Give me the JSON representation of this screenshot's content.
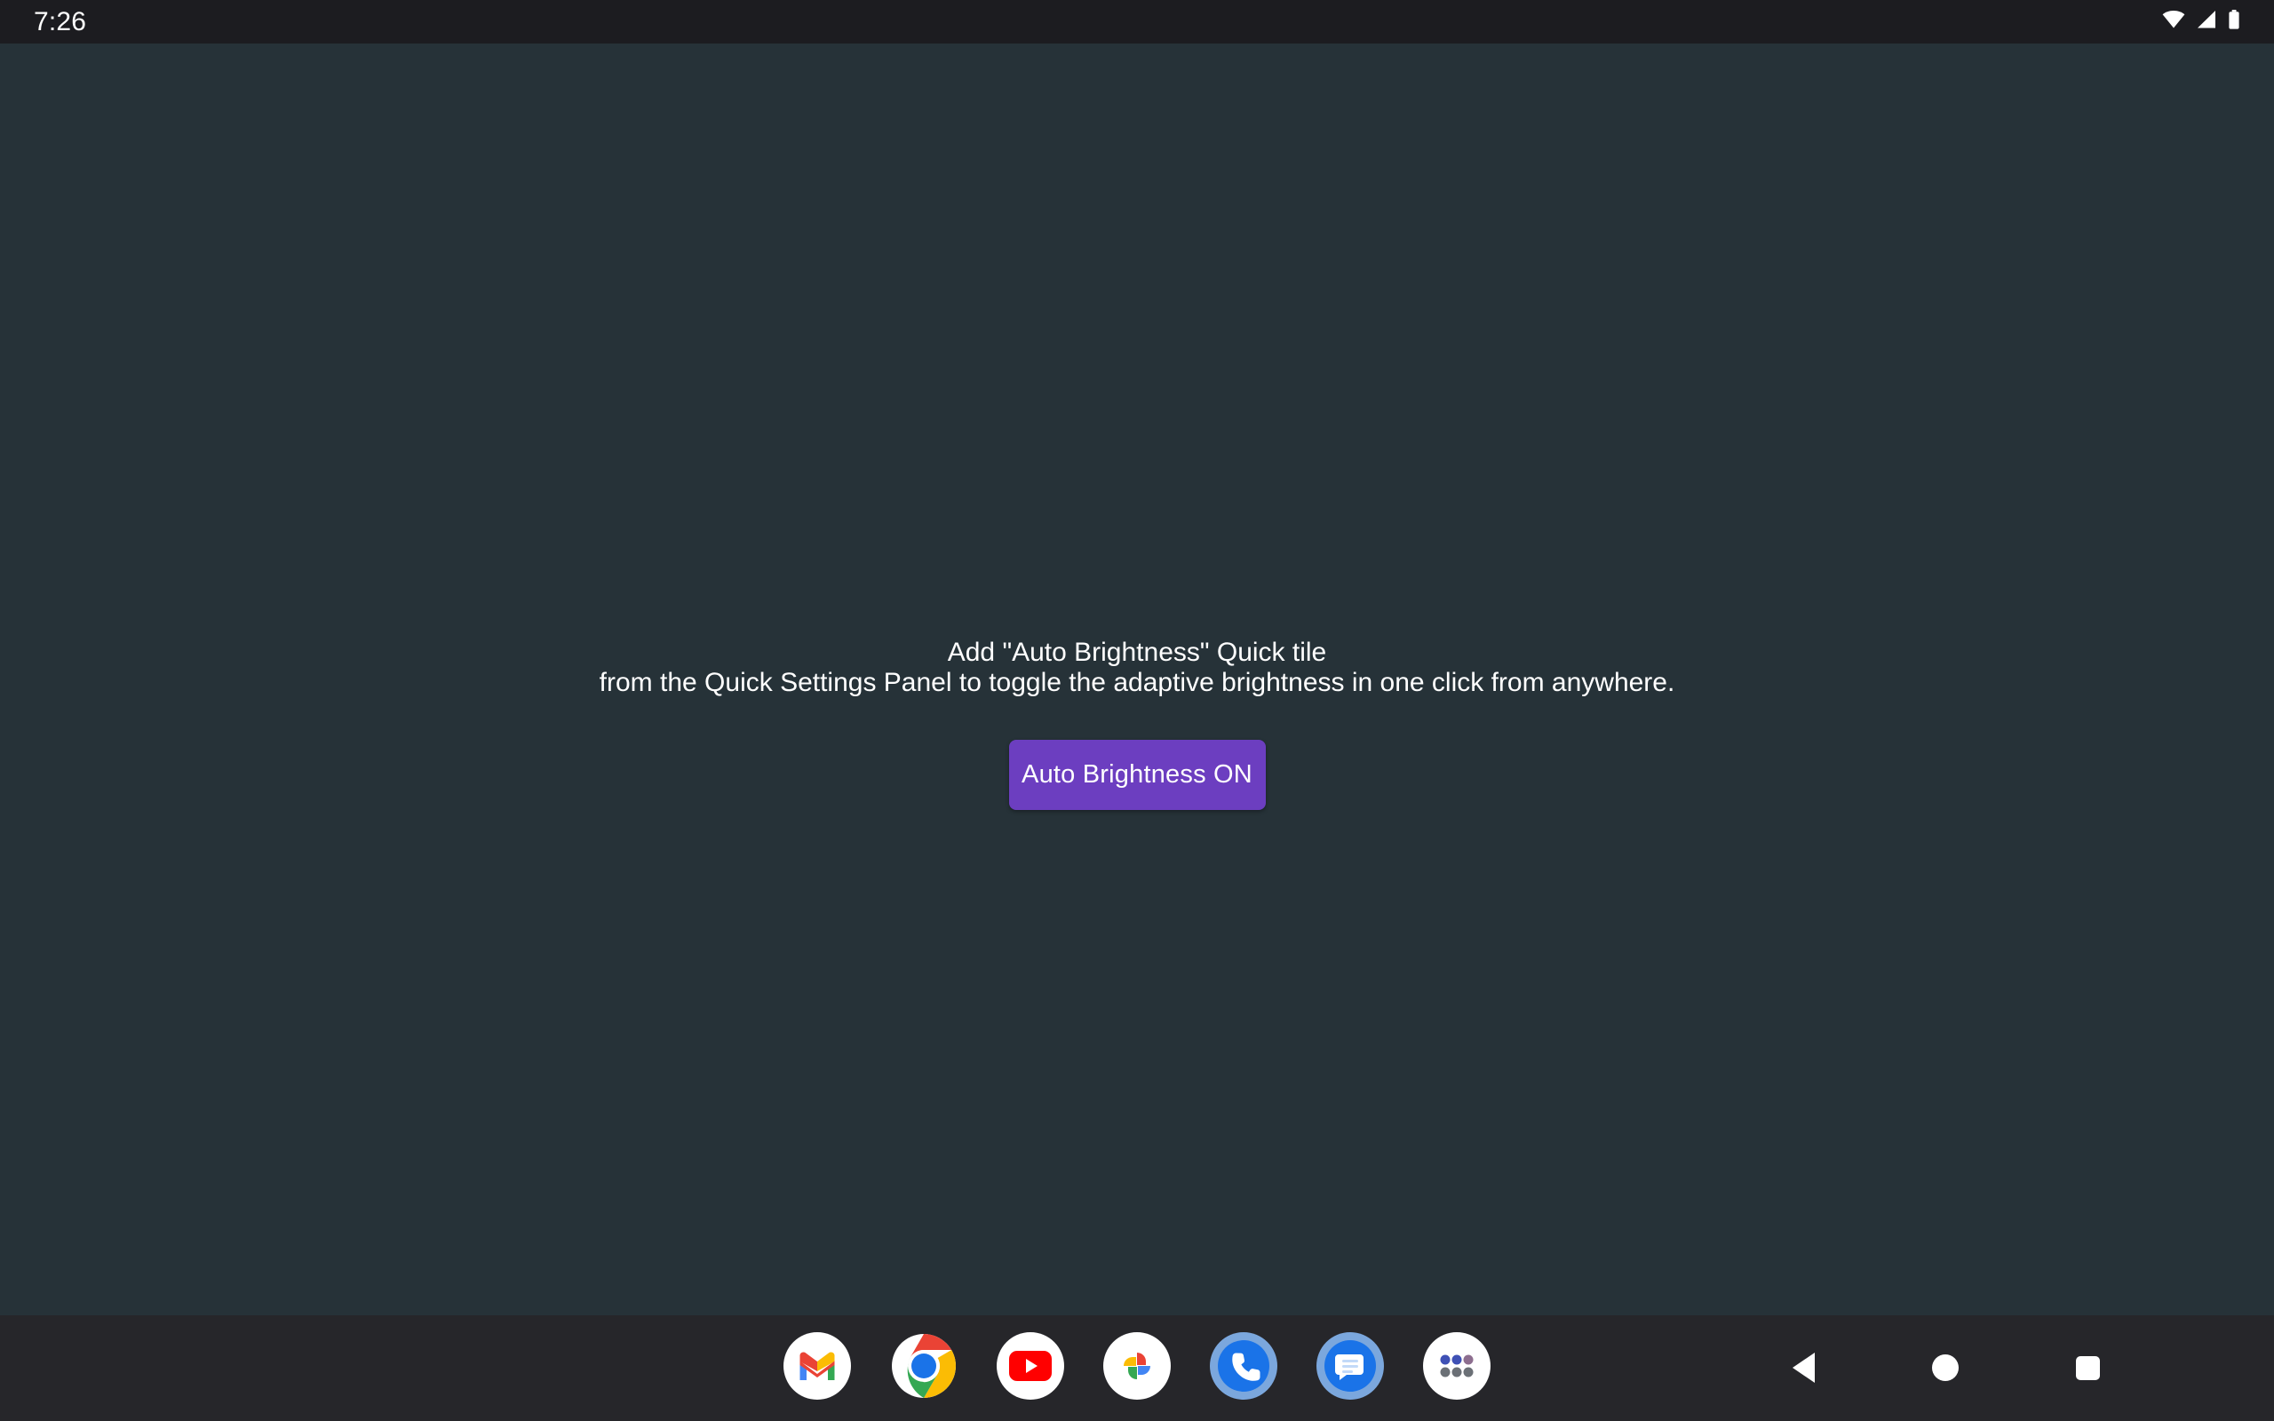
{
  "status_bar": {
    "time": "7:26",
    "icons": [
      {
        "name": "wifi-icon"
      },
      {
        "name": "cellular-signal-icon"
      },
      {
        "name": "battery-icon"
      }
    ]
  },
  "main": {
    "instruction_line1": "Add \"Auto Brightness\" Quick tile",
    "instruction_line2": "from the Quick Settings Panel to toggle the adaptive brightness in one click from anywhere.",
    "toggle_button_label": "Auto Brightness ON",
    "accent_color": "#6c3ec0",
    "background_color": "#263238"
  },
  "dock": {
    "background_color": "#26262a",
    "apps": [
      {
        "name": "gmail-icon",
        "label": "Gmail"
      },
      {
        "name": "chrome-icon",
        "label": "Chrome"
      },
      {
        "name": "youtube-icon",
        "label": "YouTube"
      },
      {
        "name": "google-photos-icon",
        "label": "Photos"
      },
      {
        "name": "phone-icon",
        "label": "Phone"
      },
      {
        "name": "messages-icon",
        "label": "Messages"
      },
      {
        "name": "app-drawer-icon",
        "label": "All apps"
      }
    ]
  },
  "navigation_bar": {
    "buttons": [
      {
        "name": "nav-back-button",
        "label": "Back"
      },
      {
        "name": "nav-home-button",
        "label": "Home"
      },
      {
        "name": "nav-recents-button",
        "label": "Recents"
      }
    ]
  }
}
